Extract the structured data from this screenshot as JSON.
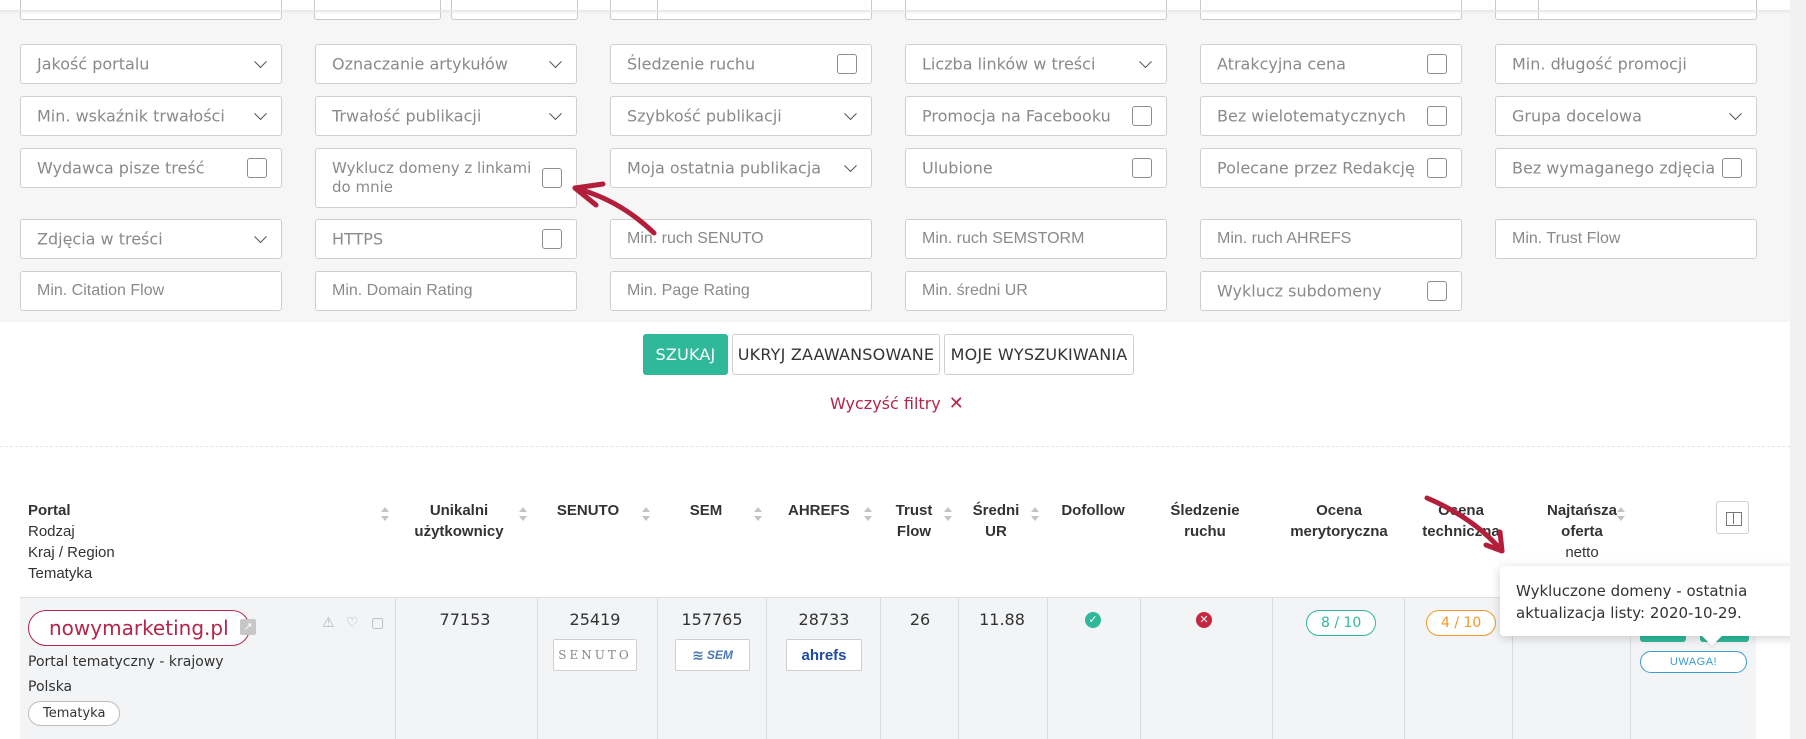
{
  "filters": {
    "row1": [
      "Jakość portalu",
      "Oznaczanie artykułów",
      "Śledzenie ruchu",
      "Liczba linków w treści",
      "Atrakcyjna cena",
      "Min. długość promocji"
    ],
    "row2": [
      "Min. wskaźnik trwałości",
      "Trwałość publikacji",
      "Szybkość publikacji",
      "Promocja na Facebooku",
      "Bez wielotematycznych",
      "Grupa docelowa"
    ],
    "row3": [
      "Wydawca pisze treść",
      "Wyklucz domeny z linkami do mnie",
      "Moja ostatnia publikacja",
      "Ulubione",
      "Polecane przez Redakcję",
      "Bez wymaganego zdjęcia"
    ],
    "row4": [
      "Zdjęcia w treści",
      "HTTPS",
      "Min. ruch SENUTO",
      "Min. ruch SEMSTORM",
      "Min. ruch AHREFS",
      "Min. Trust Flow"
    ],
    "row5": [
      "Min. Citation Flow",
      "Min. Domain Rating",
      "Min. Page Rating",
      "Min. średni UR",
      "Wyklucz subdomeny"
    ]
  },
  "actions": {
    "search": "SZUKAJ",
    "hide_advanced": "UKRYJ ZAAWANSOWANE",
    "my_searches": "MOJE WYSZUKIWANIA",
    "clear_filters": "Wyczyść filtry"
  },
  "table": {
    "headers": {
      "portal": [
        "Portal",
        "Rodzaj",
        "Kraj / Region",
        "Tematyka"
      ],
      "unique_users": [
        "Unikalni",
        "użytkownicy"
      ],
      "senuto": "SENUTO",
      "sem": "SEM",
      "ahrefs": "AHREFS",
      "trust_flow": [
        "Trust",
        "Flow"
      ],
      "avg_ur": [
        "Średni",
        "UR"
      ],
      "dofollow": "Dofollow",
      "tracking": [
        "Śledzenie",
        "ruchu"
      ],
      "content_score": [
        "Ocena",
        "merytoryczna"
      ],
      "tech_score": [
        "Ocena",
        "techniczna"
      ],
      "cheapest": [
        "Najtańsza",
        "oferta"
      ],
      "cheapest_sub": "netto"
    },
    "rows": [
      {
        "domain": "nowymarketing.pl",
        "type": "Portal tematyczny - krajowy",
        "country": "Polska",
        "topic": "Tematyka",
        "unique_users": "77153",
        "senuto": "25419",
        "sem": "157765",
        "ahrefs": "28733",
        "trust_flow": "26",
        "avg_ur": "11.88",
        "content_score": "8 / 10",
        "tech_score": "4 / 10",
        "warning": "UWAGA!"
      }
    ]
  },
  "logos": {
    "senuto": "SENUTO",
    "sem": "SEM",
    "ahrefs": "ahrefs"
  },
  "tooltip": {
    "text": "Wykluczone domeny - ostatnia aktualizacja listy: 2020-10-29."
  },
  "colors": {
    "primary": "#2fb99a",
    "accent": "#b3264a",
    "warning": "#f0992b",
    "info": "#3a9ccf"
  }
}
